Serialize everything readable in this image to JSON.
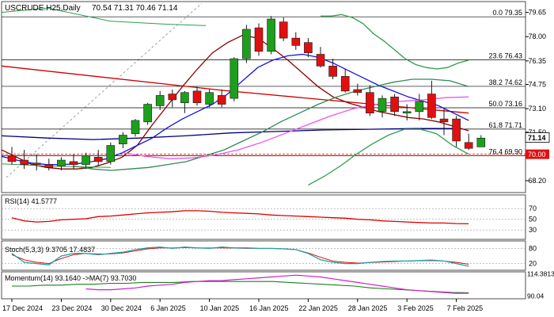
{
  "chart_data": {
    "type": "candlestick",
    "header": {
      "symbol": "USCRUDE.H25,Daily",
      "ohlc": "70.54 71.31 70.46 71.14"
    },
    "x_ticks": [
      {
        "i": 0,
        "label": "17 Dec 2024"
      },
      {
        "i": 4,
        "label": "23 Dec 2024"
      },
      {
        "i": 8,
        "label": "30 Dec 2024"
      },
      {
        "i": 12,
        "label": "6 Jan 2025"
      },
      {
        "i": 16,
        "label": "10 Jan 2025"
      },
      {
        "i": 20,
        "label": "16 Jan 2025"
      },
      {
        "i": 24,
        "label": "22 Jan 2025"
      },
      {
        "i": 28,
        "label": "28 Jan 2025"
      },
      {
        "i": 32,
        "label": "3 Feb 2025"
      },
      {
        "i": 36,
        "label": "7 Feb 2025"
      }
    ],
    "price_axis": {
      "min": 67.5,
      "max": 79.9,
      "ticks": [
        "79.65",
        "78.00",
        "76.35",
        "74.75",
        "73.10",
        "71.50",
        "69.85",
        "68.20"
      ],
      "current_price": "71.14",
      "level_label": "70.00",
      "level_value": 70.0
    },
    "fibonacci": [
      {
        "label": "0.0 79.35",
        "value": 79.35
      },
      {
        "label": "23.6 76.43",
        "value": 76.43
      },
      {
        "label": "38.2 74.62",
        "value": 74.62
      },
      {
        "label": "50.0 73.16",
        "value": 73.16
      },
      {
        "label": "61.8 71.71",
        "value": 71.71
      },
      {
        "label": "76.4 69.90",
        "value": 69.9
      }
    ],
    "candles": [
      {
        "o": 69.9,
        "h": 70.5,
        "l": 69.3,
        "c": 69.5
      },
      {
        "o": 69.6,
        "h": 70.3,
        "l": 69.0,
        "c": 69.3
      },
      {
        "o": 69.4,
        "h": 70.0,
        "l": 68.9,
        "c": 69.3
      },
      {
        "o": 69.3,
        "h": 69.7,
        "l": 68.9,
        "c": 69.1
      },
      {
        "o": 69.2,
        "h": 69.8,
        "l": 68.9,
        "c": 69.6
      },
      {
        "o": 69.5,
        "h": 70.0,
        "l": 69.0,
        "c": 69.3
      },
      {
        "o": 69.3,
        "h": 70.1,
        "l": 69.0,
        "c": 69.9
      },
      {
        "o": 69.8,
        "h": 70.3,
        "l": 69.2,
        "c": 69.5
      },
      {
        "o": 69.5,
        "h": 70.8,
        "l": 69.3,
        "c": 70.6
      },
      {
        "o": 70.7,
        "h": 71.5,
        "l": 70.4,
        "c": 71.3
      },
      {
        "o": 71.4,
        "h": 72.4,
        "l": 71.2,
        "c": 72.3
      },
      {
        "o": 72.2,
        "h": 73.5,
        "l": 72.0,
        "c": 73.4
      },
      {
        "o": 73.3,
        "h": 74.3,
        "l": 73.0,
        "c": 74.0
      },
      {
        "o": 74.1,
        "h": 74.4,
        "l": 73.2,
        "c": 73.7
      },
      {
        "o": 73.5,
        "h": 74.3,
        "l": 72.8,
        "c": 74.2
      },
      {
        "o": 74.3,
        "h": 74.6,
        "l": 73.3,
        "c": 73.5
      },
      {
        "o": 73.4,
        "h": 74.4,
        "l": 73.2,
        "c": 74.2
      },
      {
        "o": 74.0,
        "h": 74.4,
        "l": 73.2,
        "c": 73.4
      },
      {
        "o": 73.8,
        "h": 76.6,
        "l": 73.6,
        "c": 76.5
      },
      {
        "o": 76.5,
        "h": 78.8,
        "l": 76.2,
        "c": 78.5
      },
      {
        "o": 78.6,
        "h": 78.9,
        "l": 76.7,
        "c": 77.0
      },
      {
        "o": 77.0,
        "h": 79.4,
        "l": 76.8,
        "c": 79.2
      },
      {
        "o": 79.0,
        "h": 79.3,
        "l": 77.7,
        "c": 77.9
      },
      {
        "o": 77.9,
        "h": 78.3,
        "l": 77.1,
        "c": 77.4
      },
      {
        "o": 77.6,
        "h": 77.9,
        "l": 76.6,
        "c": 76.9
      },
      {
        "o": 76.8,
        "h": 77.3,
        "l": 75.9,
        "c": 76.0
      },
      {
        "o": 76.0,
        "h": 76.5,
        "l": 75.1,
        "c": 75.3
      },
      {
        "o": 75.3,
        "h": 75.8,
        "l": 74.2,
        "c": 74.3
      },
      {
        "o": 74.4,
        "h": 74.8,
        "l": 74.0,
        "c": 74.2
      },
      {
        "o": 74.2,
        "h": 74.7,
        "l": 72.6,
        "c": 72.8
      },
      {
        "o": 72.9,
        "h": 74.0,
        "l": 72.5,
        "c": 73.8
      },
      {
        "o": 73.9,
        "h": 74.1,
        "l": 72.6,
        "c": 72.9
      },
      {
        "o": 72.8,
        "h": 73.4,
        "l": 72.3,
        "c": 72.9
      },
      {
        "o": 72.9,
        "h": 74.1,
        "l": 72.3,
        "c": 73.6
      },
      {
        "o": 74.1,
        "h": 75.0,
        "l": 72.4,
        "c": 72.5
      },
      {
        "o": 72.4,
        "h": 73.1,
        "l": 71.3,
        "c": 72.2
      },
      {
        "o": 72.4,
        "h": 72.6,
        "l": 70.5,
        "c": 70.9
      },
      {
        "o": 70.8,
        "h": 71.4,
        "l": 70.3,
        "c": 70.4
      },
      {
        "o": 70.5,
        "h": 71.3,
        "l": 70.5,
        "c": 71.1
      }
    ],
    "main_lines": [
      {
        "name": "ma-red",
        "color": "#cc0000",
        "values": [
          76.0,
          74.35,
          72.8
        ]
      },
      {
        "name": "ma-navy",
        "color": "#000080",
        "values": [
          71.25,
          71.1,
          71.0,
          71.1,
          71.25,
          71.45,
          71.55,
          71.65,
          71.7,
          71.75,
          71.75
        ]
      },
      {
        "name": "ma-dark-red",
        "color": "#8b0000",
        "values": [
          70.3,
          69.8,
          69.3,
          69.1,
          69.0,
          69.0,
          69.1,
          69.4,
          69.8,
          70.6,
          72.0,
          73.3,
          74.6,
          75.8,
          76.9,
          77.6,
          78.1,
          77.9,
          77.2,
          76.4,
          75.5,
          74.6,
          73.9,
          73.5,
          73.2,
          72.9,
          72.7,
          72.5,
          72.4,
          72.2,
          71.9,
          71.6
        ]
      },
      {
        "name": "ma-blue",
        "color": "#1515dd",
        "values": [
          69.85,
          69.6,
          69.4,
          69.3,
          69.3,
          69.35,
          69.5,
          69.7,
          70.1,
          70.6,
          71.1,
          71.8,
          72.4,
          72.9,
          73.4,
          74.1,
          75.0,
          75.9,
          76.4,
          76.7,
          76.8,
          76.6,
          76.2,
          75.7,
          75.2,
          74.7,
          74.3,
          73.9,
          73.6,
          73.3,
          72.8,
          72.3
        ]
      },
      {
        "name": "ma-green",
        "color": "#2e8b57",
        "values": [
          69.2,
          69.0,
          68.9,
          69.0,
          69.1,
          69.3,
          69.5,
          69.9,
          70.3,
          70.9,
          71.5,
          72.2,
          72.8,
          73.4,
          73.9,
          74.3,
          74.6,
          74.9,
          75.1,
          75.1,
          75.0,
          74.6
        ]
      },
      {
        "name": "ma-magenta",
        "color": "#ee55ee",
        "values": [
          70.1,
          69.85,
          69.7,
          69.75,
          69.95,
          70.3,
          70.8,
          71.4,
          72.0,
          72.6,
          73.1,
          73.4,
          73.6,
          73.7,
          73.85,
          73.9
        ]
      },
      {
        "name": "bb-upper",
        "color": "#2e9c4e",
        "values": [
          79.4,
          79.4,
          79.5,
          79.3,
          78.9,
          78.2,
          77.7,
          77.1,
          76.5,
          76.1,
          75.9,
          75.8,
          75.9,
          76.2,
          76.4
        ]
      },
      {
        "name": "bb-lower",
        "color": "#2e9c4e",
        "values": [
          67.9,
          68.5,
          69.2,
          70.0,
          70.7,
          71.3,
          71.7,
          71.7,
          71.4,
          70.6,
          70.0
        ]
      }
    ],
    "rsi_panel": {
      "label": "RSI(14) 41.5777",
      "ticks": [
        "70",
        "50",
        "30"
      ],
      "values": [
        53,
        47,
        45,
        46,
        49,
        50,
        51,
        55,
        56,
        58,
        60,
        62,
        63,
        64,
        66,
        66,
        65,
        63,
        62,
        61,
        60,
        58,
        57,
        56,
        55,
        54,
        53,
        52,
        50,
        49,
        47,
        46,
        45,
        44,
        43,
        43,
        42,
        41.6
      ]
    },
    "stoch_panel": {
      "label": "Stoch(5,3,3) 9.3705 17.4837",
      "ticks": [
        "80",
        "20"
      ],
      "k_values": [
        60,
        25,
        20,
        15,
        50,
        60,
        60,
        55,
        60,
        65,
        75,
        82,
        85,
        80,
        85,
        82,
        80,
        85,
        82,
        82,
        80,
        80,
        78,
        75,
        60,
        35,
        25,
        20,
        20,
        25,
        28,
        30,
        30,
        32,
        34,
        30,
        20,
        9.4
      ],
      "d_values": [
        55,
        35,
        25,
        20,
        40,
        55,
        60,
        58,
        58,
        62,
        70,
        78,
        82,
        82,
        83,
        82,
        82,
        82,
        81,
        80,
        80,
        80,
        78,
        75,
        62,
        45,
        30,
        25,
        22,
        24,
        26,
        28,
        30,
        31,
        32,
        30,
        25,
        17.5
      ]
    },
    "momentum_panel": {
      "label": "Momentum(14) 93.1640  ->MA(7) 93.7030",
      "ticks": [
        "114.3813",
        "90.04"
      ],
      "mom_values": [
        98,
        97,
        97,
        98,
        99,
        101,
        102,
        103,
        105,
        106,
        107,
        107,
        108,
        109,
        110,
        111,
        112,
        113,
        112,
        111,
        109,
        107,
        105,
        103,
        101,
        99,
        97,
        96,
        95,
        94,
        93,
        93.16
      ],
      "ma_values": [
        101,
        101,
        102,
        102,
        103,
        103,
        104,
        104,
        105,
        105,
        105,
        106,
        106,
        106,
        106,
        106,
        106,
        105,
        104,
        103,
        102,
        101,
        99,
        98,
        97,
        96,
        95,
        94,
        93.7
      ]
    }
  }
}
